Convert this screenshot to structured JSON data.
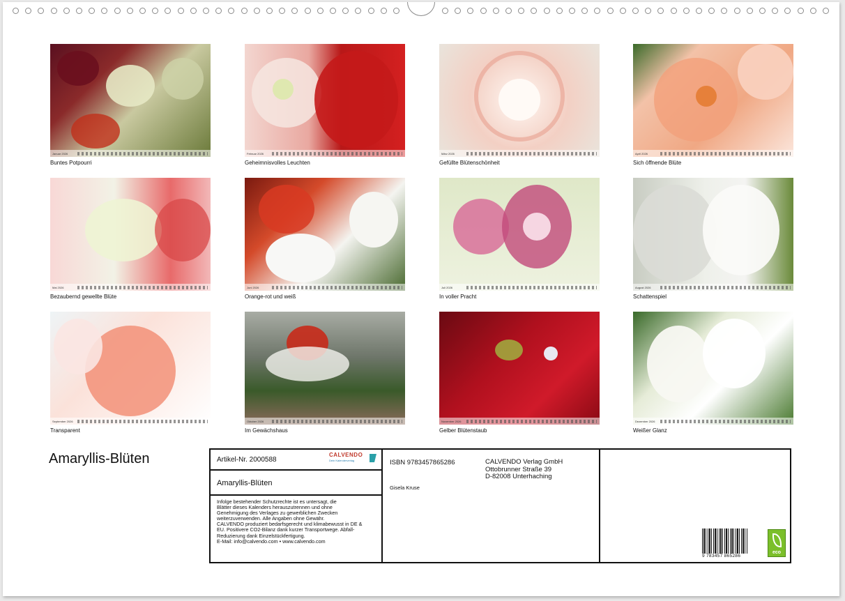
{
  "tiles": [
    {
      "caption": "Buntes Potpourri",
      "month": "Januar 2026"
    },
    {
      "caption": "Geheimnisvolles Leuchten",
      "month": "Februar 2026"
    },
    {
      "caption": "Gefüllte Blütenschönheit",
      "month": "März 2026"
    },
    {
      "caption": "Sich öffnende Blüte",
      "month": "April 2026"
    },
    {
      "caption": "Bezaubernd gewellte Blüte",
      "month": "Mai 2026"
    },
    {
      "caption": "Orange-rot und weiß",
      "month": "Juni 2026"
    },
    {
      "caption": "In voller Pracht",
      "month": "Juli 2026"
    },
    {
      "caption": "Schattenspiel",
      "month": "August 2026"
    },
    {
      "caption": "Transparent",
      "month": "September 2026"
    },
    {
      "caption": "Im Gewächshaus",
      "month": "Oktober 2026"
    },
    {
      "caption": "Gelber Blütenstaub",
      "month": "November 2026"
    },
    {
      "caption": "Weißer Glanz",
      "month": "Dezember 2026"
    }
  ],
  "title": "Amaryllis-Blüten",
  "info": {
    "article": "Artikel-Nr. 2000588",
    "brand": "CALVENDO",
    "brand_tagline": "Dein Kalenderverlag",
    "calendar_title": "Amaryllis-Blüten",
    "legal_lines": [
      "Infolge bestehender Schutzrechte ist es untersagt, die",
      "Blätter dieses Kalenders herauszutrennen und ohne",
      "Genehmigung des Verlages zu gewerblichen Zwecken",
      "weiterzuverwenden. Alle Angaben ohne Gewähr.",
      "CALVENDO produziert bedarfsgerecht und klimabewusst in DE &",
      "EU. Positivere CO2-Bilanz dank kurzer Transportwege. Abfall-",
      "Reduzierung dank Einzelstückfertigung.",
      "E-Mail: info@calvendo.com • www.calvendo.com"
    ],
    "isbn": "ISBN 9783457865286",
    "author": "Gisela Kruse",
    "publisher_lines": [
      "CALVENDO Verlag GmbH",
      "Ottobrunner Straße 39",
      "D-82008 Unterhaching"
    ],
    "barcode_number": "9 783457 865286",
    "eco_label": "eco"
  }
}
